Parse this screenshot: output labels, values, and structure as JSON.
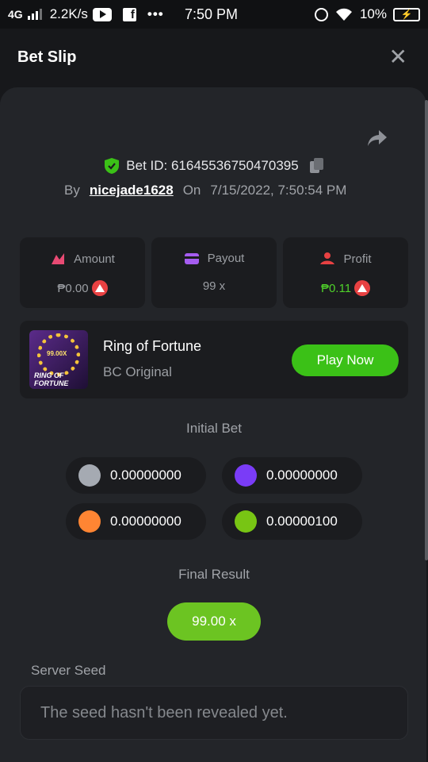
{
  "status_bar": {
    "network": "4G",
    "speed": "2.2K/s",
    "time": "7:50 PM",
    "battery": "10%"
  },
  "header": {
    "title": "Bet Slip"
  },
  "bet": {
    "id_text": "Bet ID: 61645536750470395",
    "by_label": "By",
    "username": "nicejade1628",
    "on_label": "On",
    "datetime": "7/15/2022, 7:50:54 PM"
  },
  "stats": [
    {
      "label": "Amount",
      "value": "₱0.00",
      "icon": "amount-icon",
      "icon_color": "#e84a73"
    },
    {
      "label": "Payout",
      "value": "99 x",
      "icon": "payout-icon",
      "icon_color": "#a55cf0"
    },
    {
      "label": "Profit",
      "value": "₱0.11",
      "icon": "profit-icon",
      "icon_color": "#e84142",
      "value_color": "#4fd12a"
    }
  ],
  "game": {
    "name": "Ring of Fortune",
    "subtitle": "BC Original",
    "play_label": "Play Now",
    "thumb_multiplier": "99.00X",
    "thumb_title": "RING OF FORTUNE"
  },
  "initial_bet": {
    "label": "Initial Bet",
    "options": [
      {
        "color": "#a5aab2",
        "value": "0.00000000"
      },
      {
        "color": "#7a3cf7",
        "value": "0.00000000"
      },
      {
        "color": "#ff8533",
        "value": "0.00000000"
      },
      {
        "color": "#78c514",
        "value": "0.00000100"
      }
    ]
  },
  "final_result": {
    "label": "Final Result",
    "value": "99.00 x"
  },
  "server_seed": {
    "label": "Server Seed",
    "placeholder": "The seed hasn't been revealed yet."
  },
  "colors": {
    "accent_green": "#3bc117",
    "result_green": "#6cc422"
  }
}
